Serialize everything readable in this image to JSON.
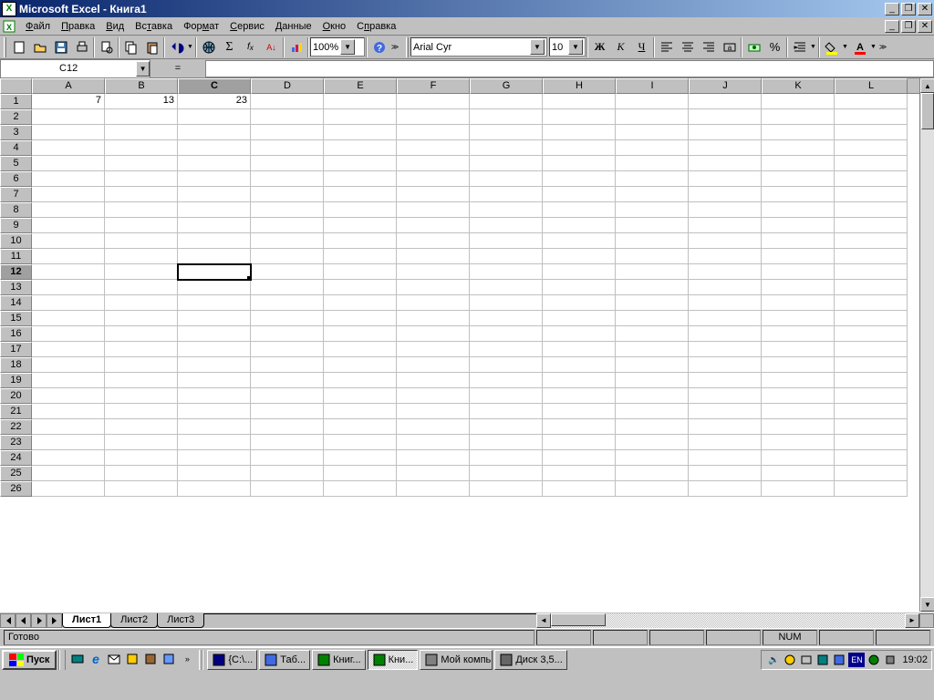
{
  "title": "Microsoft Excel - Книга1",
  "menu": [
    "Файл",
    "Правка",
    "Вид",
    "Вставка",
    "Формат",
    "Сервис",
    "Данные",
    "Окно",
    "Справка"
  ],
  "menu_underlines": [
    0,
    0,
    0,
    2,
    3,
    0,
    0,
    0,
    1
  ],
  "toolbar": {
    "zoom": "100%",
    "font": "Arial Cyr",
    "fontsize": "10"
  },
  "formula": {
    "name": "C12",
    "value": ""
  },
  "columns": [
    "A",
    "B",
    "C",
    "D",
    "E",
    "F",
    "G",
    "H",
    "I",
    "J",
    "K",
    "L"
  ],
  "active_col": "C",
  "rows": 26,
  "active_row": 12,
  "cells": {
    "A1": "7",
    "B1": "13",
    "C1": "23"
  },
  "sheets": [
    "Лист1",
    "Лист2",
    "Лист3"
  ],
  "active_sheet": 0,
  "status": {
    "ready": "Готово",
    "num": "NUM"
  },
  "taskbar": {
    "start": "Пуск",
    "tasks": [
      {
        "label": "{C:\\...",
        "icon": "cmd"
      },
      {
        "label": "Таб...",
        "icon": "word"
      },
      {
        "label": "Книг...",
        "icon": "excel"
      },
      {
        "label": "Кни...",
        "icon": "excel",
        "active": true
      },
      {
        "label": "Мой компьютер",
        "icon": "pc"
      },
      {
        "label": "Диск 3,5...",
        "icon": "floppy"
      }
    ],
    "clock": "19:02",
    "lang": "EN"
  }
}
